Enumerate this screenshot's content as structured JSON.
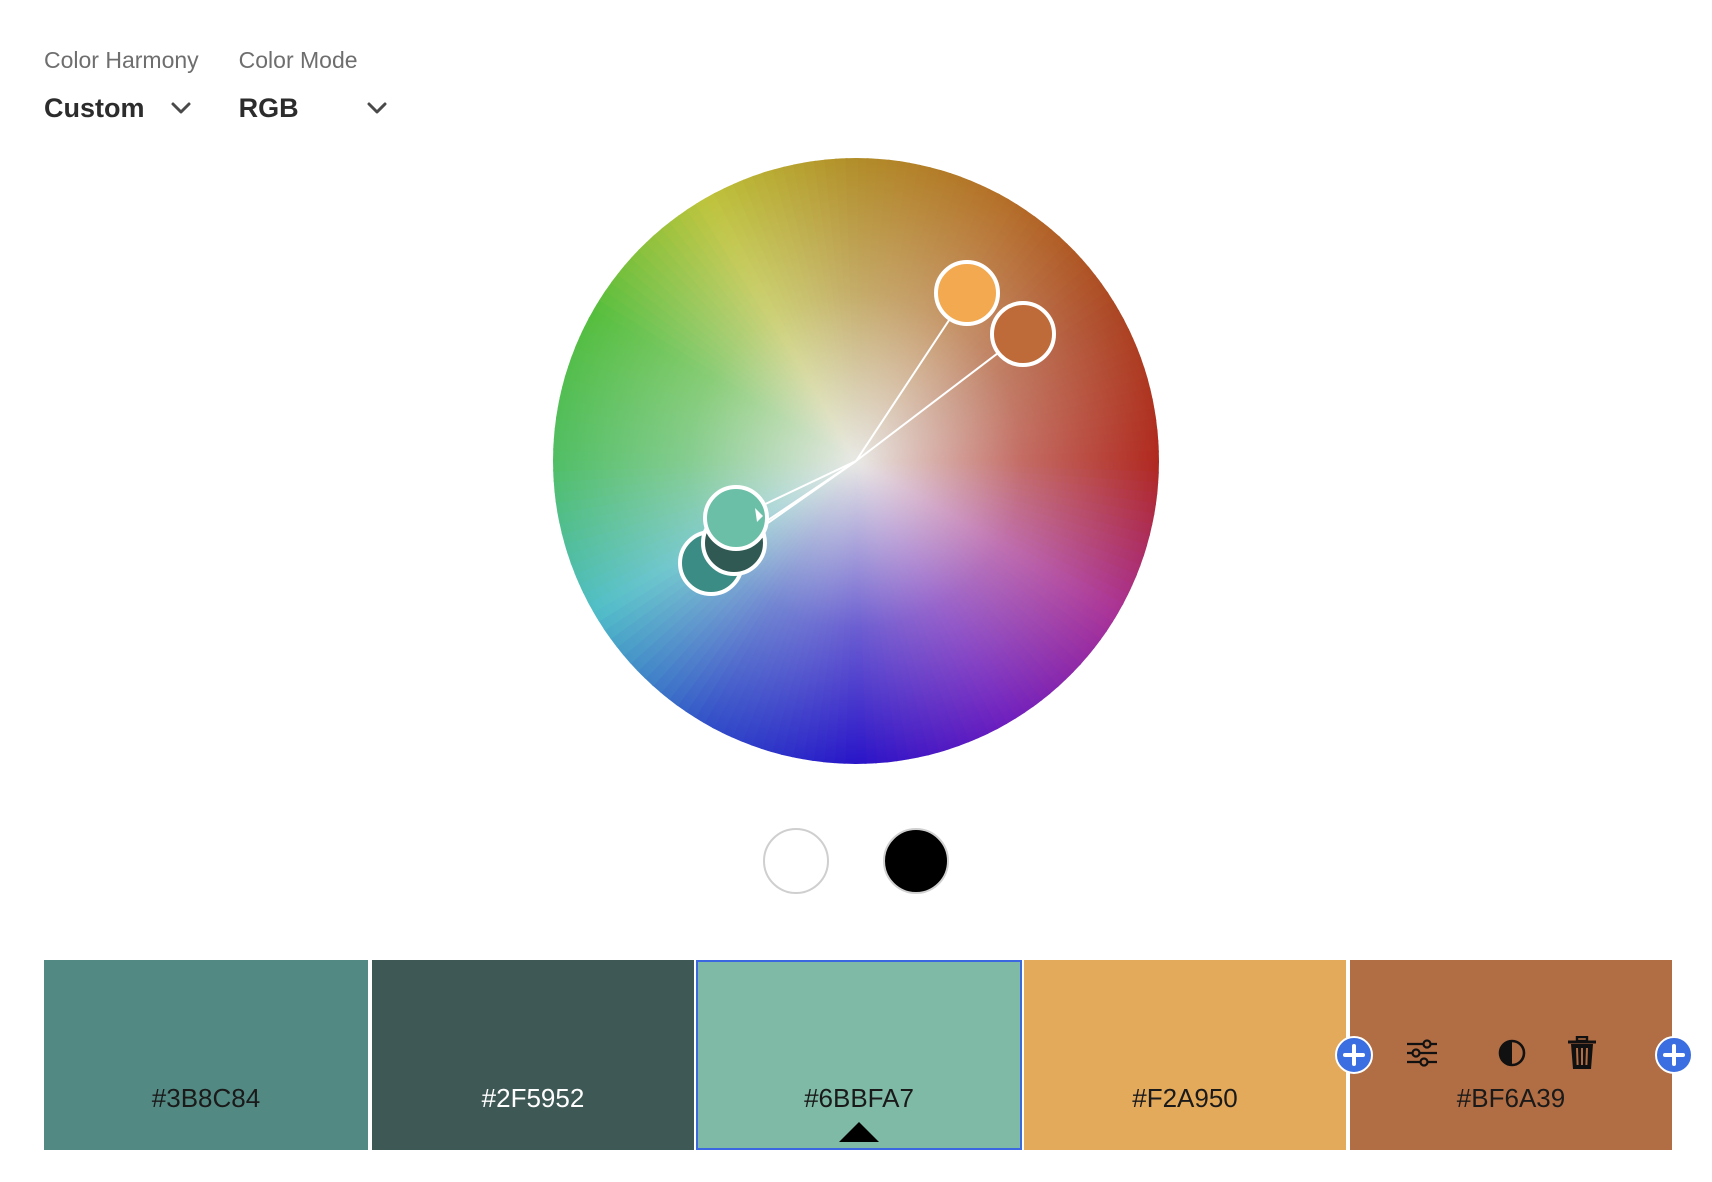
{
  "harmony": {
    "label": "Color Harmony",
    "value": "Custom"
  },
  "mode": {
    "label": "Color Mode",
    "value": "RGB"
  },
  "wheel": {
    "markers": [
      {
        "color": "#3B8C84"
      },
      {
        "color": "#2F5952"
      },
      {
        "color": "#6BBFA7"
      },
      {
        "color": "#F2A950"
      },
      {
        "color": "#BF6A39"
      }
    ]
  },
  "swatches": [
    {
      "hex": "#3B8C84",
      "color": "#528a83",
      "text_color": "#1a1a1a"
    },
    {
      "hex": "#2F5952",
      "color": "#3e5955",
      "text_color": "#ffffff"
    },
    {
      "hex": "#6BBFA7",
      "color": "#7ebaa6",
      "text_color": "#1a1a1a",
      "selected": true
    },
    {
      "hex": "#F2A950",
      "color": "#e4aa5c",
      "text_color": "#1a1a1a"
    },
    {
      "hex": "#BF6A39",
      "color": "#b16d43",
      "text_color": "#1a1a1a"
    }
  ],
  "accent": "#3b6ee0"
}
